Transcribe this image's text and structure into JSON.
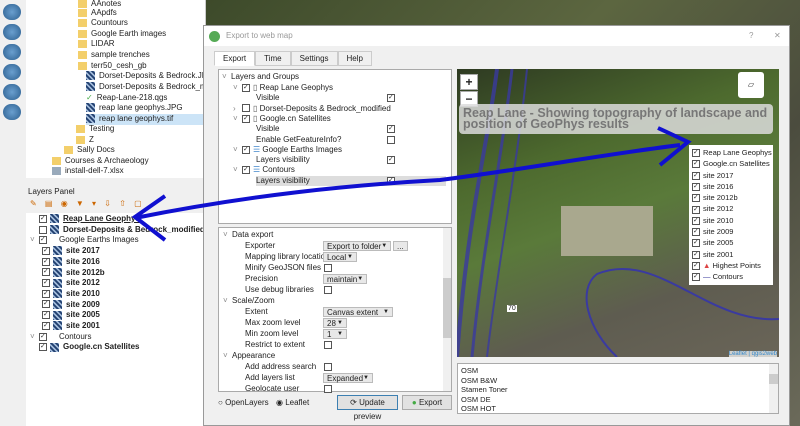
{
  "browser": {
    "folders": [
      "AAnotes",
      "AApdfs",
      "Countours",
      "Google Earth images",
      "LIDAR",
      "sample trenches",
      "terr50_cesh_gb"
    ],
    "files": [
      "Dorset-Deposits & Bedrock.JPG",
      "Dorset-Deposits & Bedrock_modified.",
      "Reap-Lane-218.qgs",
      "reap lane geophys.JPG",
      "reap lane geophys.tif"
    ],
    "more": [
      "Testing",
      "Z",
      "Sally Docs",
      "Courses & Archaeology",
      "install-dell-7.xlsx"
    ]
  },
  "layers_panel": {
    "title": "Layers Panel",
    "items": [
      {
        "label": "Reap Lane Geophys",
        "checked": true,
        "level": 0
      },
      {
        "label": "Dorset-Deposits & Bedrock_modified",
        "checked": false,
        "level": 0
      },
      {
        "label": "Google Earths Images",
        "checked": true,
        "level": 0,
        "group": true
      },
      {
        "label": "site 2017",
        "checked": true,
        "level": 1
      },
      {
        "label": "site 2016",
        "checked": true,
        "level": 1
      },
      {
        "label": "site 2012b",
        "checked": true,
        "level": 1
      },
      {
        "label": "site 2012",
        "checked": true,
        "level": 1
      },
      {
        "label": "site 2010",
        "checked": true,
        "level": 1
      },
      {
        "label": "site 2009",
        "checked": true,
        "level": 1
      },
      {
        "label": "site 2005",
        "checked": true,
        "level": 1
      },
      {
        "label": "site 2001",
        "checked": true,
        "level": 1
      },
      {
        "label": "Contours",
        "checked": true,
        "level": 0,
        "group": true
      },
      {
        "label": "Google.cn Satellites",
        "checked": true,
        "level": 0
      }
    ]
  },
  "dialog": {
    "title": "Export to web map",
    "help": "?",
    "close": "✕",
    "tabs": [
      "Export",
      "Time",
      "Settings",
      "Help"
    ],
    "tree": {
      "root": "Layers and Groups",
      "rows": [
        {
          "label": "Reap Lane Geophys",
          "type": "layer",
          "checked": true
        },
        {
          "label": "Visible",
          "type": "prop",
          "checked": true
        },
        {
          "label": "Dorset-Deposits & Bedrock_modified",
          "type": "layer",
          "checked": false
        },
        {
          "label": "Google.cn Satellites",
          "type": "layer",
          "checked": true
        },
        {
          "label": "Visible",
          "type": "prop",
          "checked": true
        },
        {
          "label": "Enable GetFeatureInfo?",
          "type": "prop",
          "checked": false
        },
        {
          "label": "Google Earths Images",
          "type": "group",
          "checked": true
        },
        {
          "label": "Layers visibility",
          "type": "prop",
          "checked": true
        },
        {
          "label": "Contours",
          "type": "group",
          "checked": true
        },
        {
          "label": "Layers visibility",
          "type": "prop",
          "checked": true
        }
      ]
    },
    "settings": {
      "data_export": "Data export",
      "exporter": "Exporter",
      "exporter_val": "Export to folder",
      "browse": "...",
      "maplib": "Mapping library location",
      "maplib_val": "Local",
      "minify": "Minify GeoJSON files",
      "precision": "Precision",
      "precision_val": "maintain",
      "debug": "Use debug libraries",
      "scale": "Scale/Zoom",
      "extent": "Extent",
      "extent_val": "Canvas extent",
      "maxz": "Max zoom level",
      "maxz_val": "28",
      "minz": "Min zoom level",
      "minz_val": "1",
      "restrict": "Restrict to extent",
      "appearance": "Appearance",
      "address": "Add address search",
      "layerslist": "Add layers list",
      "layerslist_val": "Expanded",
      "geolocate": "Geolocate user"
    },
    "radio_openlayers": "OpenLayers",
    "radio_leaflet": "Leaflet",
    "update": "Update preview",
    "export": "Export",
    "preview": {
      "title": "Reap Lane - Showing topography of landscape and position of GeoPhys results",
      "zoom_in": "+",
      "zoom_out": "−",
      "road": "70",
      "legend": [
        "Reap Lane Geophys",
        "Google.cn Satellites",
        "site 2017",
        "site 2016",
        "site 2012b",
        "site 2012",
        "site 2010",
        "site 2009",
        "site 2005",
        "site 2001",
        "Highest Points",
        "Contours"
      ],
      "attribution": "Leaflet | qgis2web"
    },
    "basemaps": [
      "OSM",
      "OSM B&W",
      "Stamen Toner",
      "OSM DE",
      "OSM HOT"
    ]
  }
}
